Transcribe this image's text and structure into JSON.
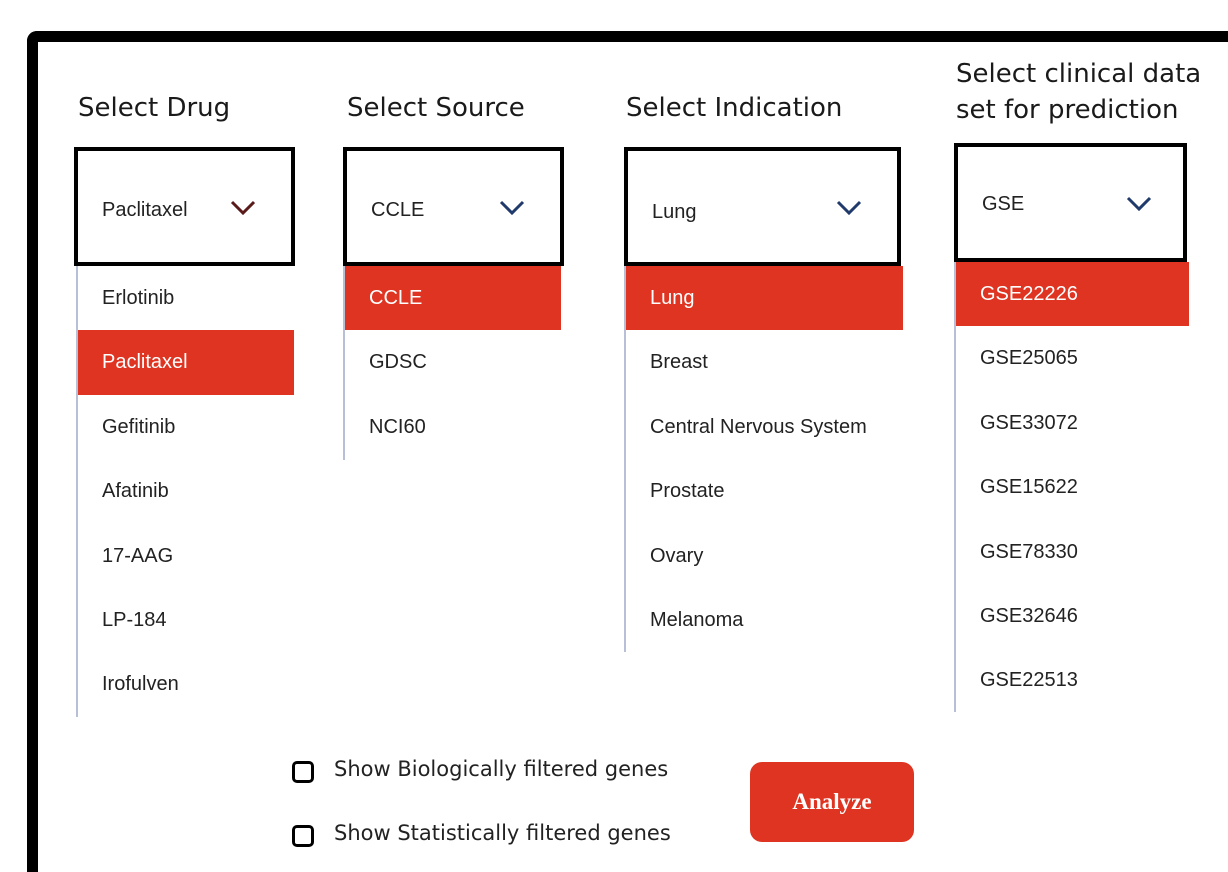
{
  "columns": {
    "drug": {
      "title": "Select Drug",
      "value": "Paclitaxel",
      "chevron_color": "#5a1a1a",
      "options": [
        "Erlotinib",
        "Paclitaxel",
        "Gefitinib",
        "Afatinib",
        "17-AAG",
        "LP-184",
        "Irofulven"
      ],
      "selected": "Paclitaxel"
    },
    "source": {
      "title": "Select Source",
      "value": "CCLE",
      "chevron_color": "#1f3a6b",
      "options": [
        "CCLE",
        "GDSC",
        "NCI60"
      ],
      "selected": "CCLE"
    },
    "indication": {
      "title": "Select Indication",
      "value": "Lung",
      "chevron_color": "#1f3a6b",
      "options": [
        "Lung",
        "Breast",
        "Central Nervous System",
        "Prostate",
        "Ovary",
        "Melanoma"
      ],
      "selected": "Lung"
    },
    "clinical": {
      "title_line1": "Select clinical data",
      "title_line2": "set for prediction",
      "value": "GSE",
      "chevron_color": "#1f3a6b",
      "options": [
        "GSE22226",
        "GSE25065",
        "GSE33072",
        "GSE15622",
        "GSE78330",
        "GSE32646",
        "GSE22513"
      ],
      "selected": "GSE22226"
    }
  },
  "filters": {
    "biological_label": "Show Biologically filtered genes",
    "statistical_label": "Show Statistically filtered genes",
    "biological_checked": false,
    "statistical_checked": false
  },
  "actions": {
    "analyze_label": "Analyze"
  },
  "colors": {
    "accent": "#de3421",
    "border": "#000000"
  }
}
